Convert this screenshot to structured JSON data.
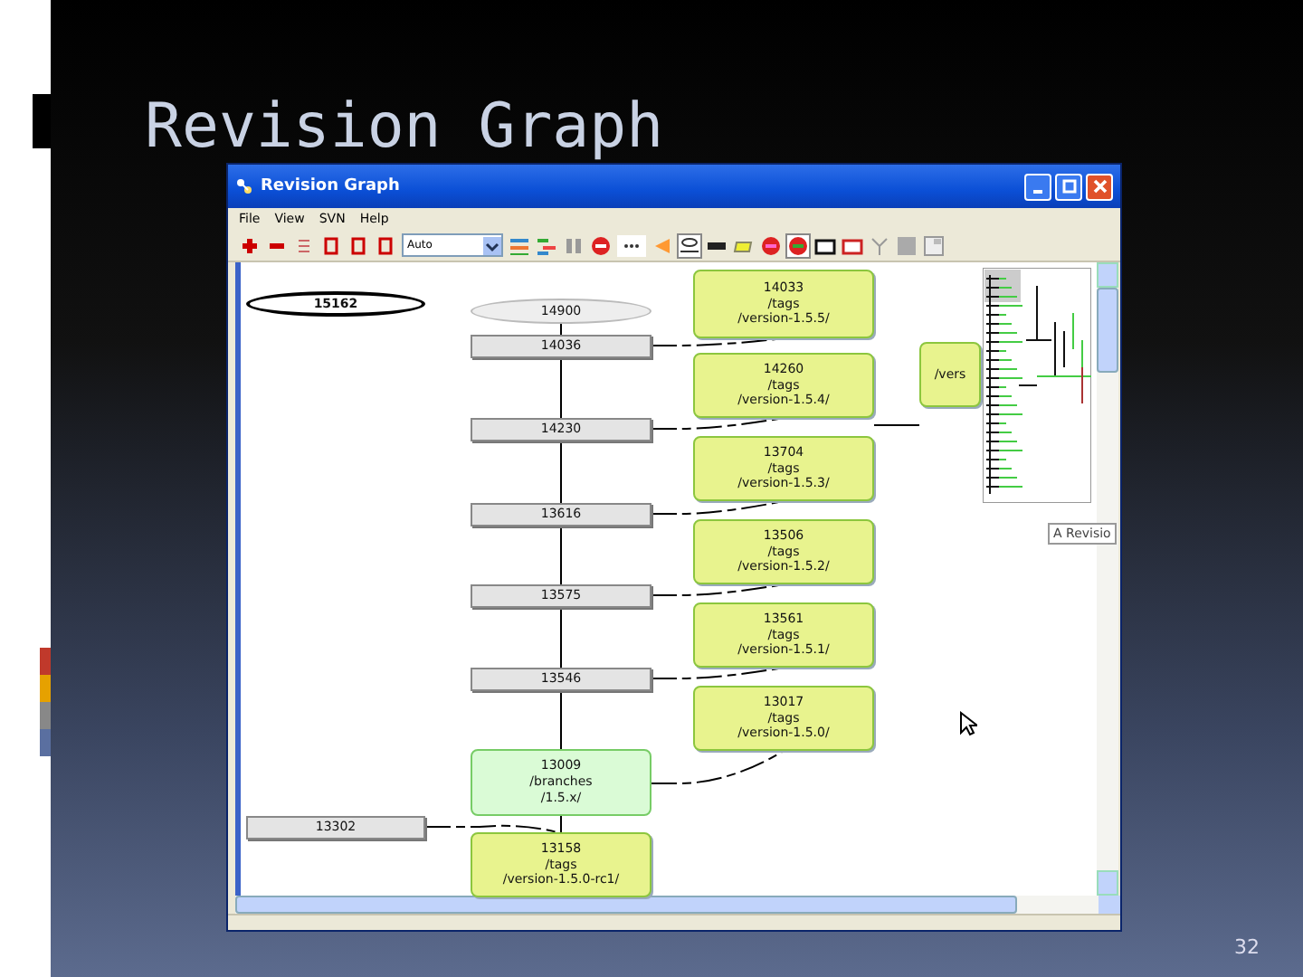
{
  "slide": {
    "title": "Revision Graph",
    "page_number": "32"
  },
  "window": {
    "title": "Revision Graph",
    "menu": [
      "File",
      "View",
      "SVN",
      "Help"
    ],
    "zoom": "Auto"
  },
  "graph": {
    "nodes": [
      {
        "kind": "head",
        "lines": [
          "15162"
        ]
      },
      {
        "kind": "tag",
        "lines": [
          "14033",
          "/tags",
          "/version-1.5.5/"
        ]
      },
      {
        "kind": "deleted",
        "lines": [
          "14900"
        ]
      },
      {
        "kind": "revision",
        "lines": [
          "14036"
        ]
      },
      {
        "kind": "tag",
        "lines": [
          "14260",
          "/tags",
          "/version-1.5.4/"
        ]
      },
      {
        "kind": "revision",
        "lines": [
          "14230"
        ]
      },
      {
        "kind": "tag",
        "lines": [
          "13704",
          "/tags",
          "/version-1.5.3/"
        ]
      },
      {
        "kind": "revision",
        "lines": [
          "13616"
        ]
      },
      {
        "kind": "tag",
        "lines": [
          "13506",
          "/tags",
          "/version-1.5.2/"
        ]
      },
      {
        "kind": "revision",
        "lines": [
          "13575"
        ]
      },
      {
        "kind": "tag",
        "lines": [
          "13561",
          "/tags",
          "/version-1.5.1/"
        ]
      },
      {
        "kind": "revision",
        "lines": [
          "13546"
        ]
      },
      {
        "kind": "tag",
        "lines": [
          "13017",
          "/tags",
          "/version-1.5.0/"
        ]
      },
      {
        "kind": "branch",
        "lines": [
          "13009",
          "/branches",
          "/1.5.x/"
        ]
      },
      {
        "kind": "revision",
        "lines": [
          "13302"
        ]
      },
      {
        "kind": "tag",
        "lines": [
          "13158",
          "/tags",
          "/version-1.5.0-rc1/"
        ]
      },
      {
        "kind": "tag",
        "lines": [
          "/vers"
        ]
      }
    ],
    "tooltip": "A Revisio"
  }
}
